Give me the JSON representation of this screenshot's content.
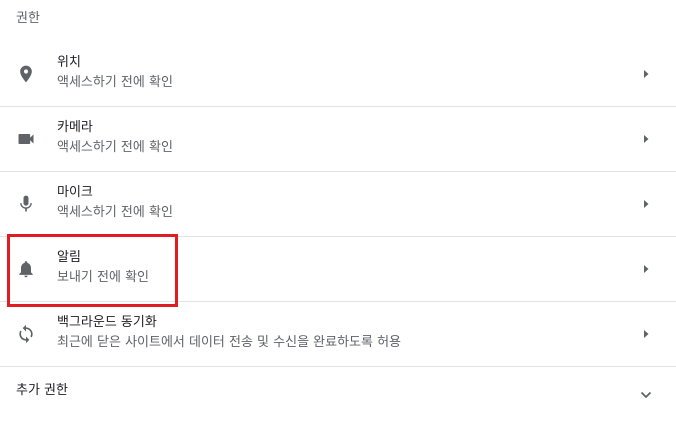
{
  "section": {
    "title": "권한"
  },
  "permissions": [
    {
      "icon": "location-pin-icon",
      "title": "위치",
      "subtitle": "액세스하기 전에 확인"
    },
    {
      "icon": "videocam-icon",
      "title": "카메라",
      "subtitle": "액세스하기 전에 확인"
    },
    {
      "icon": "microphone-icon",
      "title": "마이크",
      "subtitle": "액세스하기 전에 확인"
    },
    {
      "icon": "bell-icon",
      "title": "알림",
      "subtitle": "보내기 전에 확인"
    },
    {
      "icon": "sync-icon",
      "title": "백그라운드 동기화",
      "subtitle": "최근에 닫은 사이트에서 데이터 전송 및 수신을 완료하도록 허용"
    }
  ],
  "more": {
    "label": "추가 권한",
    "icon": "chevron-down-icon"
  },
  "colors": {
    "highlight": "#e11d24",
    "icon": "#5f6368",
    "divider": "#e3e3e3"
  }
}
